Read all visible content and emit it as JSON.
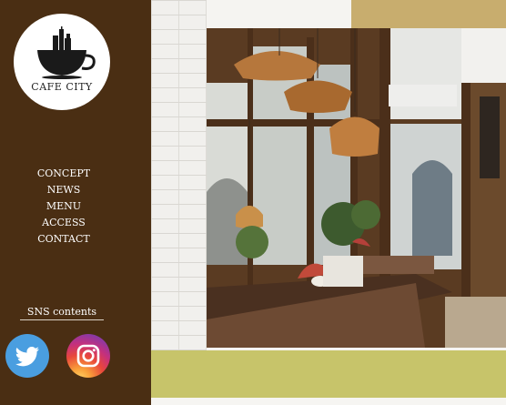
{
  "brand": {
    "name": "CAFE CITY"
  },
  "nav": {
    "items": [
      {
        "label": "CONCEPT"
      },
      {
        "label": "NEWS"
      },
      {
        "label": "MENU"
      },
      {
        "label": "ACCESS"
      },
      {
        "label": "CONTACT"
      }
    ]
  },
  "sns": {
    "title": "SNS contents",
    "icons": [
      "twitter-icon",
      "instagram-icon"
    ]
  },
  "colors": {
    "sidebar": "#4a2e13",
    "accent_gold": "#c8ad6e",
    "accent_olive": "#c7c46a",
    "twitter": "#4a9ee0"
  }
}
